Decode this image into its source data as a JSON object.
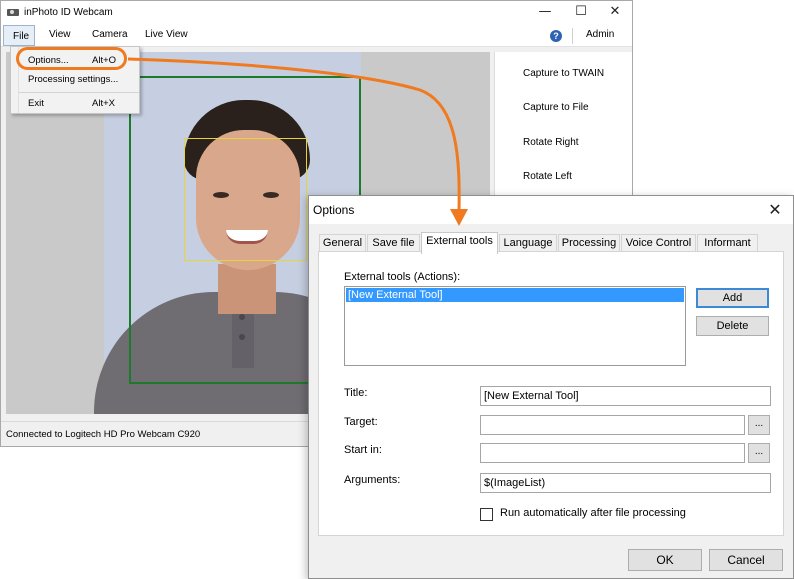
{
  "app": {
    "title": "inPhoto ID Webcam",
    "window_controls": {
      "minimize": "—",
      "maximize": "☐",
      "close": "✕"
    }
  },
  "menubar": {
    "items": [
      "File",
      "View",
      "Camera",
      "Live View"
    ],
    "help_icon": "?",
    "admin_label": "Admin"
  },
  "file_menu": {
    "items": [
      {
        "label": "Options...",
        "shortcut": "Alt+O"
      },
      {
        "label": "Processing settings...",
        "shortcut": ""
      },
      {
        "label": "Exit",
        "shortcut": "Alt+X"
      }
    ]
  },
  "command_panel": {
    "items": [
      "Capture to TWAIN",
      "Capture to File",
      "Rotate Right",
      "Rotate Left"
    ]
  },
  "status": {
    "text": "Connected to Logitech HD Pro Webcam C920"
  },
  "options_dialog": {
    "title": "Options",
    "close_label": "✕",
    "tabs": [
      "General",
      "Save file",
      "External tools",
      "Language",
      "Processing",
      "Voice Control",
      "Informant"
    ],
    "active_tab": "External tools",
    "external_tools_label": "External tools (Actions):",
    "tools_list": [
      "[New External Tool]"
    ],
    "add_button": "Add",
    "delete_button": "Delete",
    "fields": {
      "title_label": "Title:",
      "title_value": "[New External Tool]",
      "target_label": "Target:",
      "target_value": "",
      "start_in_label": "Start in:",
      "start_in_value": "",
      "arguments_label": "Arguments:",
      "arguments_value": "$(ImageList)",
      "browse_label": "..."
    },
    "run_auto_label": "Run automatically after file processing",
    "run_auto_checked": false,
    "ok_button": "OK",
    "cancel_button": "Cancel"
  },
  "colors": {
    "annotation_orange": "#f07a1f",
    "selection_blue": "#3399ff",
    "frame_green": "#1e7a2b",
    "frame_yellow": "#e6d43a"
  }
}
